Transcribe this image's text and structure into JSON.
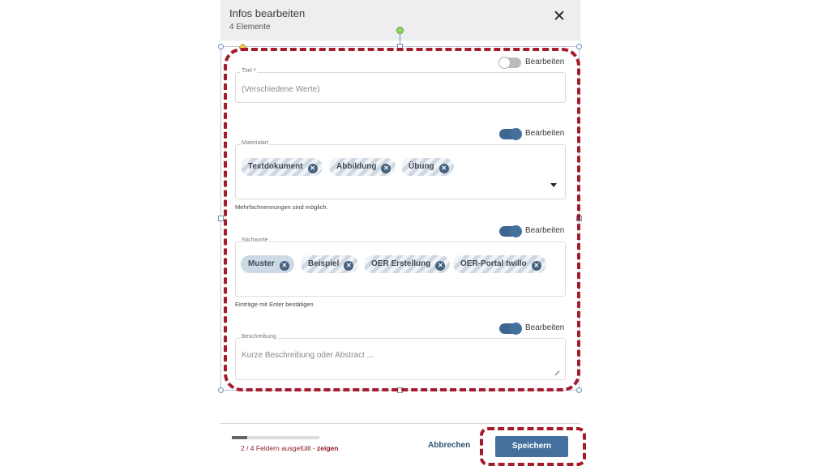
{
  "dialog": {
    "title": "Infos bearbeiten",
    "subtitle": "4 Elemente",
    "close_icon": "close-icon"
  },
  "fields": {
    "titel": {
      "label": "Titel",
      "required_mark": "*",
      "placeholder": "(Verschiedene Werte)",
      "edit_label": "Bearbeiten",
      "edit_enabled": false
    },
    "materialart": {
      "label": "Materialart",
      "chips": [
        "Textdokument",
        "Abbildung",
        "Übung"
      ],
      "hint": "Mehrfachnennungen sind möglich.",
      "edit_label": "Bearbeiten",
      "edit_enabled": true
    },
    "stichworte": {
      "label": "Stichworte",
      "chips": [
        "Muster",
        "Beispiel",
        "OER Erstellung",
        "OER-Portal twillo"
      ],
      "hint": "Einträge mit Enter bestätigen",
      "edit_label": "Bearbeiten",
      "edit_enabled": true
    },
    "beschreibung": {
      "label": "Beschreibung",
      "placeholder": "Kurze Beschreibung oder Abstract ...",
      "edit_label": "Bearbeiten",
      "edit_enabled": true
    }
  },
  "footer": {
    "progress_filled": 2,
    "progress_total": 4,
    "progress_text": "2 / 4 Feldern ausgefüllt - ",
    "progress_link": "zeigen",
    "cancel_label": "Abbrechen",
    "save_label": "Speichern"
  },
  "colors": {
    "accent": "#45709e",
    "annotation": "#a61b2b",
    "header_bg": "#eeeeee"
  }
}
